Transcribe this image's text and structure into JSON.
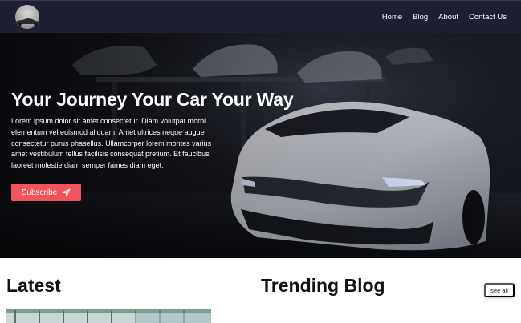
{
  "nav": {
    "logo_icon": "car-logo-icon",
    "links": [
      "Home",
      "Blog",
      "About",
      "Contact Us"
    ]
  },
  "hero": {
    "title": "Your Journey Your Car Your Way",
    "text": "Lorem ipsum dolor sit amet consectetur. Diam volutpat morbi elementum vel euismod aliquam. Amet ultrices neque augue consectetur purus phasellus. Ullamcorper lorem montes varius amet vestibulum tellus facilisis consequat pretium. Et faucibus laoreet molestie diam semper fames diam eget.",
    "subscribe_label": "Subscribe",
    "subscribe_icon": "send-icon",
    "accent": "#f2545b"
  },
  "sections": {
    "latest_title": "Latest",
    "trending_title": "Trending Blog",
    "see_all_label": "see all"
  }
}
